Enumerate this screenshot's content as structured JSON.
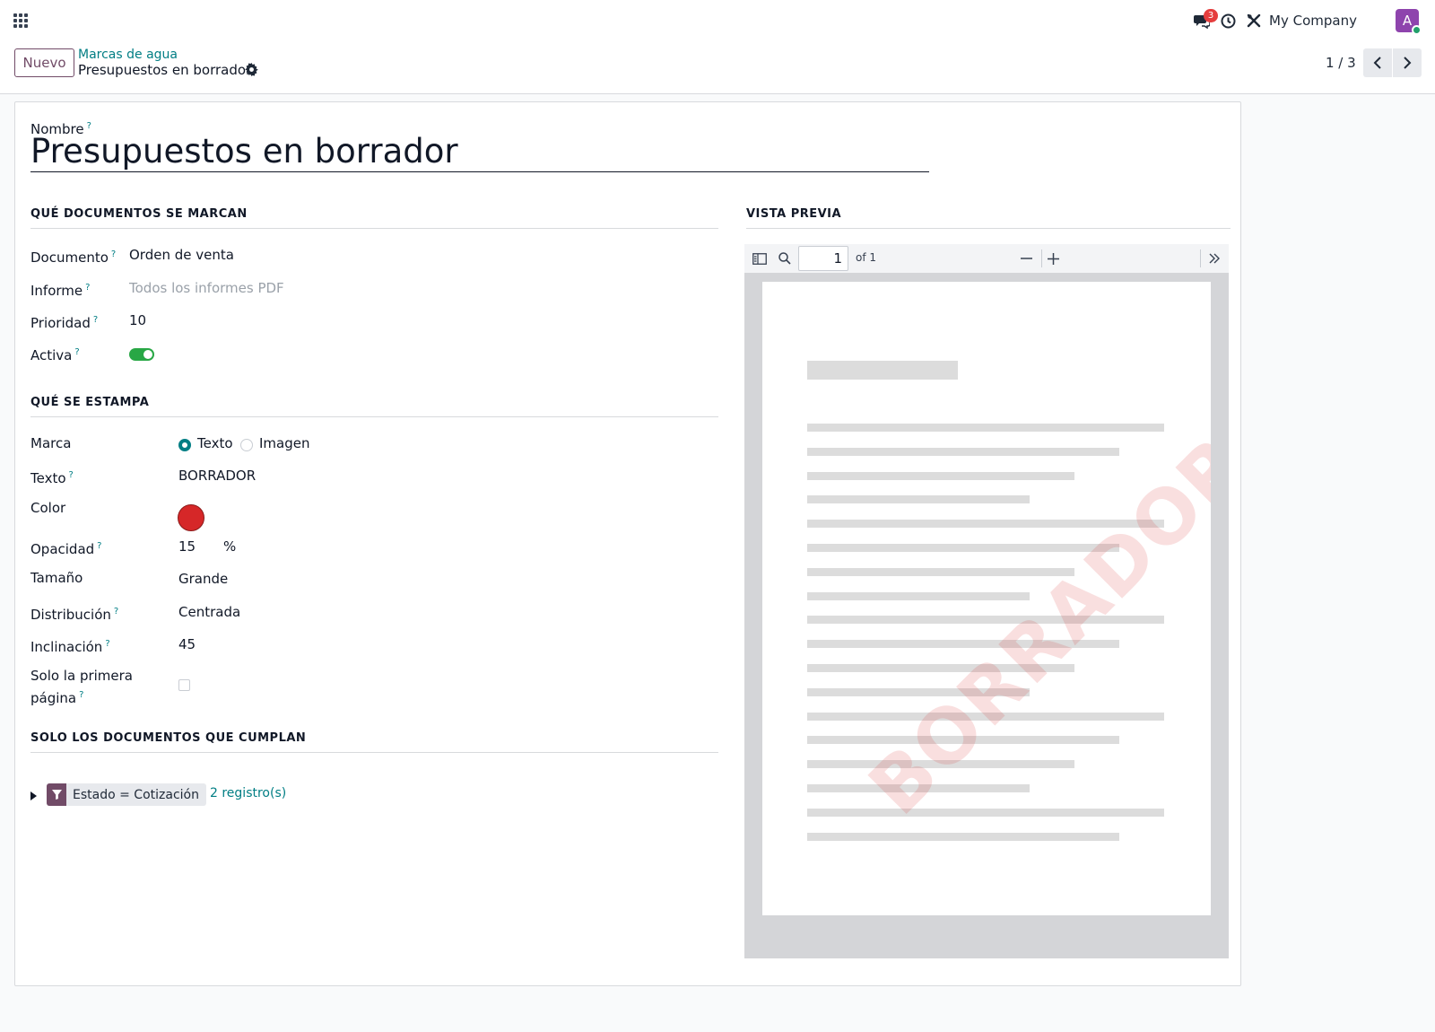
{
  "navbar": {
    "chat_badge": "3",
    "company": "My Company",
    "avatar_initial": "A"
  },
  "control": {
    "new_button": "Nuevo",
    "breadcrumb_parent": "Marcas de agua",
    "breadcrumb_current": "Presupuestos en borrador",
    "pager": "1 / 3"
  },
  "form": {
    "name_label": "Nombre",
    "name_value": "Presupuestos en borrador",
    "help_mark": "?",
    "section_docs": "QUÉ DOCUMENTOS SE MARCAN",
    "documento_label": "Documento",
    "documento_value": "Orden de venta",
    "informe_label": "Informe",
    "informe_placeholder": "Todos los informes PDF",
    "prioridad_label": "Prioridad",
    "prioridad_value": "10",
    "activa_label": "Activa",
    "activa_on": true,
    "section_stamp": "QUÉ SE ESTAMPA",
    "marca_label": "Marca",
    "marca_options": [
      "Texto",
      "Imagen"
    ],
    "marca_selected": "Texto",
    "texto_label": "Texto",
    "texto_value": "BORRADOR",
    "color_label": "Color",
    "color_value": "#d62728",
    "opacidad_label": "Opacidad",
    "opacidad_value": "15",
    "opacidad_unit": "%",
    "tamano_label": "Tamaño",
    "tamano_value": "Grande",
    "distribucion_label": "Distribución",
    "distribucion_value": "Centrada",
    "inclinacion_label": "Inclinación",
    "inclinacion_value": "45",
    "solo_primera_label_1": "Solo la primera",
    "solo_primera_label_2": "página",
    "solo_primera_checked": false,
    "section_domain": "SOLO LOS DOCUMENTOS QUE CUMPLAN",
    "domain_text": "Estado = Cotización",
    "domain_records": "2 registro(s)"
  },
  "preview": {
    "section_title": "VISTA PREVIA",
    "page_number": "1",
    "page_of": "of 1",
    "watermark_text": "BORRADOR"
  },
  "colors": {
    "brand": "#714b67",
    "link": "#017e84",
    "toggle_on": "#28a745"
  }
}
